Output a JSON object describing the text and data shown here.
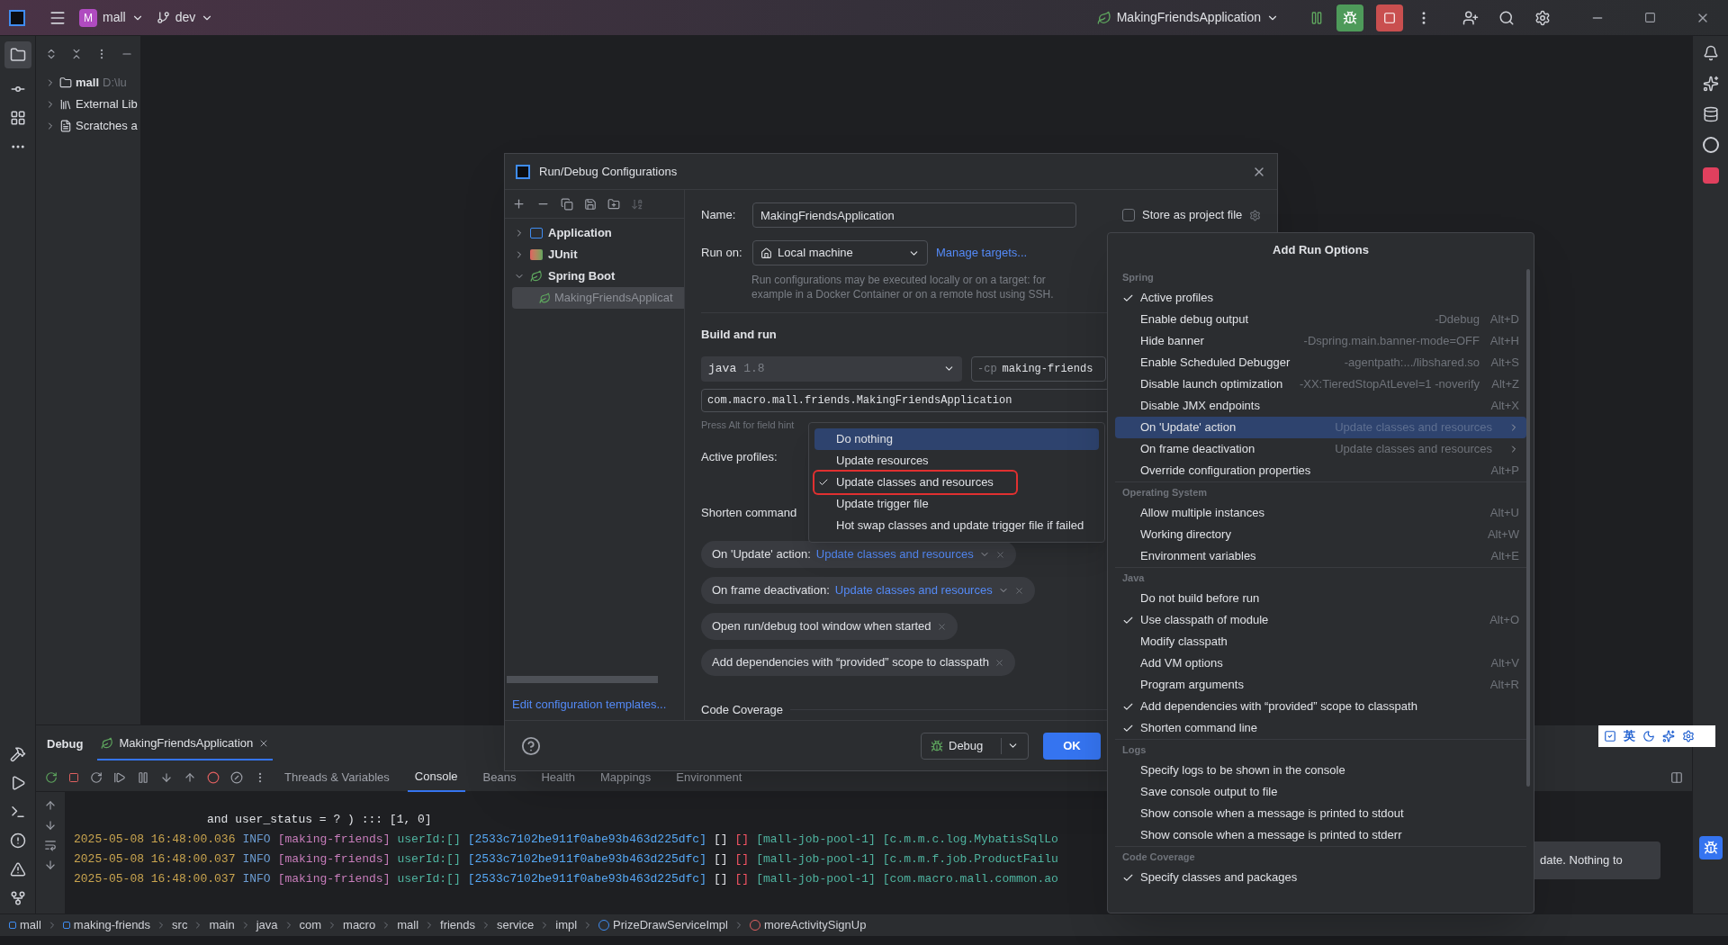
{
  "title_bar": {
    "project_badge": "M",
    "project": "mall",
    "branch": "dev",
    "run_config": "MakingFriendsApplication"
  },
  "project_tree": [
    {
      "label": "mall",
      "detail": "D:\\lu",
      "kind": "module"
    },
    {
      "label": "External Lib",
      "kind": "libraries"
    },
    {
      "label": "Scratches a",
      "kind": "scratches"
    }
  ],
  "dialog": {
    "title": "Run/Debug Configurations",
    "config_tree": [
      {
        "label": "Application",
        "kind": "application",
        "expanded": false
      },
      {
        "label": "JUnit",
        "kind": "junit",
        "expanded": false
      },
      {
        "label": "Spring Boot",
        "kind": "spring",
        "expanded": true,
        "children": [
          {
            "label": "MakingFriendsApplicat",
            "selected": true
          }
        ]
      }
    ],
    "edit_templates": "Edit configuration templates...",
    "name_label": "Name:",
    "name_value": "MakingFriendsApplication",
    "store_label": "Store as project file",
    "store_checked": false,
    "run_on_label": "Run on:",
    "run_on_value": "Local machine",
    "manage_targets": "Manage targets...",
    "run_on_hint": [
      "Run configurations may be executed locally or on a target: for",
      "example in a Docker Container or on a remote host using SSH."
    ],
    "build_heading": "Build and run",
    "jdk": "java",
    "jdk_version": "1.8",
    "cp_flag": "-cp",
    "cp_module": "making-friends",
    "main_class": "com.macro.mall.friends.MakingFriendsApplication",
    "field_hint": "Press Alt for field hint",
    "active_profiles_label": "Active profiles:",
    "shorten_label": "Shorten command",
    "chips": [
      {
        "label": "On 'Update' action:",
        "value": "Update classes and resources"
      },
      {
        "label": "On frame deactivation:",
        "value": "Update classes and resources"
      },
      {
        "label": "Open run/debug tool window when started"
      },
      {
        "label": "Add dependencies with “provided” scope to classpath"
      }
    ],
    "code_coverage": "Code Coverage",
    "debug_button": "Debug",
    "ok_button": "OK"
  },
  "update_dropdown": [
    {
      "label": "Do nothing",
      "selected": true,
      "checked": false,
      "outlined": false
    },
    {
      "label": "Update resources",
      "selected": false,
      "checked": false,
      "outlined": false
    },
    {
      "label": "Update classes and resources",
      "selected": false,
      "checked": true,
      "outlined": true
    },
    {
      "label": "Update trigger file",
      "selected": false,
      "checked": false,
      "outlined": false
    },
    {
      "label": "Hot swap classes and update trigger file if failed",
      "selected": false,
      "checked": false,
      "outlined": false
    }
  ],
  "run_options": {
    "title": "Add Run Options",
    "sections": [
      {
        "heading": "Spring",
        "items": [
          {
            "label": "Active profiles",
            "checked": true,
            "selected": false
          },
          {
            "label": "Enable debug output",
            "hint": "-Ddebug",
            "shortcut": "Alt+D",
            "checked": false,
            "selected": false
          },
          {
            "label": "Hide banner",
            "hint": "-Dspring.main.banner-mode=OFF",
            "shortcut": "Alt+H",
            "checked": false,
            "selected": false
          },
          {
            "label": "Enable Scheduled Debugger",
            "hint": "-agentpath:.../libshared.so",
            "shortcut": "Alt+S",
            "checked": false,
            "selected": false
          },
          {
            "label": "Disable launch optimization",
            "hint": "-XX:TieredStopAtLevel=1 -noverify",
            "shortcut": "Alt+Z",
            "checked": false,
            "selected": false
          },
          {
            "label": "Disable JMX endpoints",
            "shortcut": "Alt+X",
            "checked": false,
            "selected": false
          },
          {
            "label": "On 'Update' action",
            "hint": "Update classes and resources",
            "submenu": true,
            "checked": false,
            "selected": true
          },
          {
            "label": "On frame deactivation",
            "hint": "Update classes and resources",
            "submenu": true,
            "checked": false,
            "selected": false
          },
          {
            "label": "Override configuration properties",
            "shortcut": "Alt+P",
            "checked": false,
            "selected": false
          }
        ]
      },
      {
        "heading": "Operating System",
        "items": [
          {
            "label": "Allow multiple instances",
            "shortcut": "Alt+U",
            "checked": false,
            "selected": false
          },
          {
            "label": "Working directory",
            "shortcut": "Alt+W",
            "checked": false,
            "selected": false
          },
          {
            "label": "Environment variables",
            "shortcut": "Alt+E",
            "checked": false,
            "selected": false
          }
        ]
      },
      {
        "heading": "Java",
        "items": [
          {
            "label": "Do not build before run",
            "checked": false,
            "selected": false
          },
          {
            "label": "Use classpath of module",
            "shortcut": "Alt+O",
            "checked": true,
            "selected": false
          },
          {
            "label": "Modify classpath",
            "checked": false,
            "selected": false
          },
          {
            "label": "Add VM options",
            "shortcut": "Alt+V",
            "checked": false,
            "selected": false
          },
          {
            "label": "Program arguments",
            "shortcut": "Alt+R",
            "checked": false,
            "selected": false
          },
          {
            "label": "Add dependencies with “provided” scope to classpath",
            "checked": true,
            "selected": false
          },
          {
            "label": "Shorten command line",
            "checked": true,
            "selected": false
          }
        ]
      },
      {
        "heading": "Logs",
        "items": [
          {
            "label": "Specify logs to be shown in the console",
            "checked": false,
            "selected": false
          },
          {
            "label": "Save console output to file",
            "checked": false,
            "selected": false
          },
          {
            "label": "Show console when a message is printed to stdout",
            "checked": false,
            "selected": false
          },
          {
            "label": "Show console when a message is printed to stderr",
            "checked": false,
            "selected": false
          }
        ]
      },
      {
        "heading": "Code Coverage",
        "items": [
          {
            "label": "Specify classes and packages",
            "checked": true,
            "selected": false
          }
        ]
      }
    ]
  },
  "debug_panel": {
    "title": "Debug",
    "session_tab": "MakingFriendsApplication",
    "tabs": [
      {
        "label": "Threads & Variables",
        "selected": false
      },
      {
        "label": "Console",
        "selected": true
      },
      {
        "label": "Beans",
        "selected": false
      },
      {
        "label": "Health",
        "selected": false
      },
      {
        "label": "Mappings",
        "selected": false
      },
      {
        "label": "Environment",
        "selected": false
      }
    ],
    "continuation": "and user_status = ? ) ::: [1, 0]",
    "lines": [
      {
        "time": "2025-05-08 16:48:00.036",
        "level": "INFO",
        "app": "[making-friends]",
        "user": "userId:[]",
        "trace": "[2533c7102be911f0abe93b463d225dfc]",
        "bracket_a": "[]",
        "bracket_b": "[]",
        "thread": "[mall-job-pool-1]",
        "logger": "[c.m.m.c.log.MybatisSqlLo"
      },
      {
        "time": "2025-05-08 16:48:00.037",
        "level": "INFO",
        "app": "[making-friends]",
        "user": "userId:[]",
        "trace": "[2533c7102be911f0abe93b463d225dfc]",
        "bracket_a": "[]",
        "bracket_b": "[]",
        "thread": "[mall-job-pool-1]",
        "logger": "[c.m.m.f.job.ProductFailu"
      },
      {
        "time": "2025-05-08 16:48:00.037",
        "level": "INFO",
        "app": "[making-friends]",
        "user": "userId:[]",
        "trace": "[2533c7102be911f0abe93b463d225dfc]",
        "bracket_a": "[]",
        "bracket_b": "[]",
        "thread": "[mall-job-pool-1]",
        "logger": "[com.macro.mall.common.ao"
      }
    ]
  },
  "notification": "date. Nothing to",
  "ime_label": "英",
  "breadcrumbs": [
    {
      "label": "mall",
      "kind": "module"
    },
    {
      "label": "making-friends",
      "kind": "module"
    },
    {
      "label": "src",
      "kind": "folder"
    },
    {
      "label": "main",
      "kind": "folder"
    },
    {
      "label": "java",
      "kind": "folder"
    },
    {
      "label": "com",
      "kind": "folder"
    },
    {
      "label": "macro",
      "kind": "folder"
    },
    {
      "label": "mall",
      "kind": "folder"
    },
    {
      "label": "friends",
      "kind": "folder"
    },
    {
      "label": "service",
      "kind": "folder"
    },
    {
      "label": "impl",
      "kind": "folder"
    },
    {
      "label": "PrizeDrawServiceImpl",
      "kind": "class"
    },
    {
      "label": "moreActivitySignUp",
      "kind": "method"
    }
  ]
}
